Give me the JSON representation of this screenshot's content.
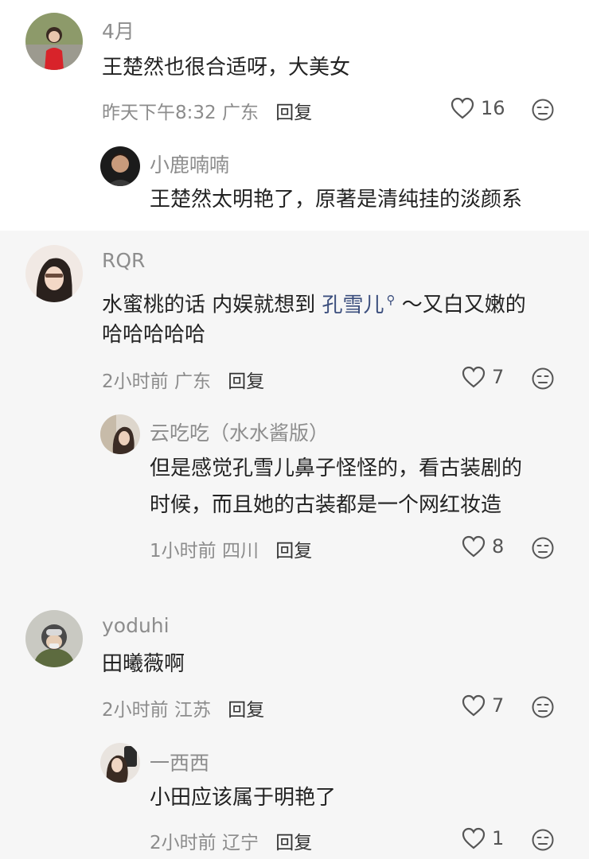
{
  "comments": [
    {
      "user": "4月",
      "text": "王楚然也很合适呀，大美女",
      "time": "昨天下午8:32",
      "location": "广东",
      "reply_label": "回复",
      "likes": "16",
      "replies": [
        {
          "user": "小鹿喃喃",
          "text": "王楚然太明艳了，原著是清纯挂的淡颜系"
        }
      ]
    },
    {
      "user": "RQR",
      "text_before": "水蜜桃的话 内娱就想到 ",
      "mention": "孔雪儿",
      "text_after": " ～又白又嫩的",
      "text_line2": "哈哈哈哈哈",
      "time": "2小时前",
      "location": "广东",
      "reply_label": "回复",
      "likes": "7",
      "replies": [
        {
          "user": "云吃吃（水水酱版）",
          "text_line1": "但是感觉孔雪儿鼻子怪怪的，看古装剧的",
          "text_line2": "时候，而且她的古装都是一个网红妆造",
          "time": "1小时前",
          "location": "四川",
          "reply_label": "回复",
          "likes": "8"
        }
      ]
    },
    {
      "user": "yoduhi",
      "text": "田曦薇啊",
      "time": "2小时前",
      "location": "江苏",
      "reply_label": "回复",
      "likes": "7",
      "replies": [
        {
          "user": "一西西",
          "text": "小田应该属于明艳了",
          "time": "2小时前",
          "location": "辽宁",
          "reply_label": "回复",
          "likes": "1"
        }
      ]
    }
  ],
  "icons": {
    "like": "heart-outline-icon",
    "dislike": "meh-face-icon",
    "mention_search": "magnifier-icon"
  },
  "colors": {
    "name": "#8d8d8d",
    "mention": "#3b4e7d",
    "section_bg": "#f6f6f6"
  }
}
